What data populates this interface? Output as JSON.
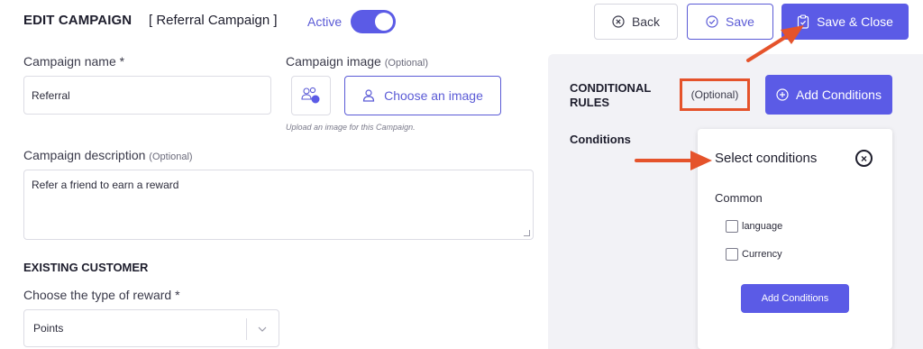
{
  "header": {
    "title": "EDIT CAMPAIGN",
    "subtitle": "[ Referral Campaign ]",
    "status_label": "Active",
    "toggle_on": true
  },
  "toolbar": {
    "back_label": "Back",
    "save_label": "Save",
    "save_close_label": "Save & Close"
  },
  "form": {
    "name_label": "Campaign name",
    "name_required": "*",
    "name_value": "Referral",
    "image_label": "Campaign image",
    "image_optional": "(Optional)",
    "choose_image_label": "Choose an image",
    "image_help": "Upload an image for this Campaign.",
    "description_label": "Campaign description",
    "description_optional": "(Optional)",
    "description_value": "Refer a friend to earn a reward",
    "existing_customer_heading": "EXISTING CUSTOMER",
    "reward_type_label": "Choose the type of reward",
    "reward_type_required": "*",
    "reward_type_value": "Points"
  },
  "conditional_rules": {
    "title": "CONDITIONAL RULES",
    "optional_label": "(Optional)",
    "add_conditions_label": "Add Conditions",
    "conditions_label": "Conditions"
  },
  "select_conditions_popup": {
    "title": "Select conditions",
    "group_label": "Common",
    "options": [
      {
        "label": "language",
        "checked": false
      },
      {
        "label": "Currency",
        "checked": false
      }
    ],
    "add_button_label": "Add Conditions"
  },
  "colors": {
    "accent": "#5b5be6",
    "annotation": "#e5532b",
    "panel_bg": "#f2f2f6"
  }
}
